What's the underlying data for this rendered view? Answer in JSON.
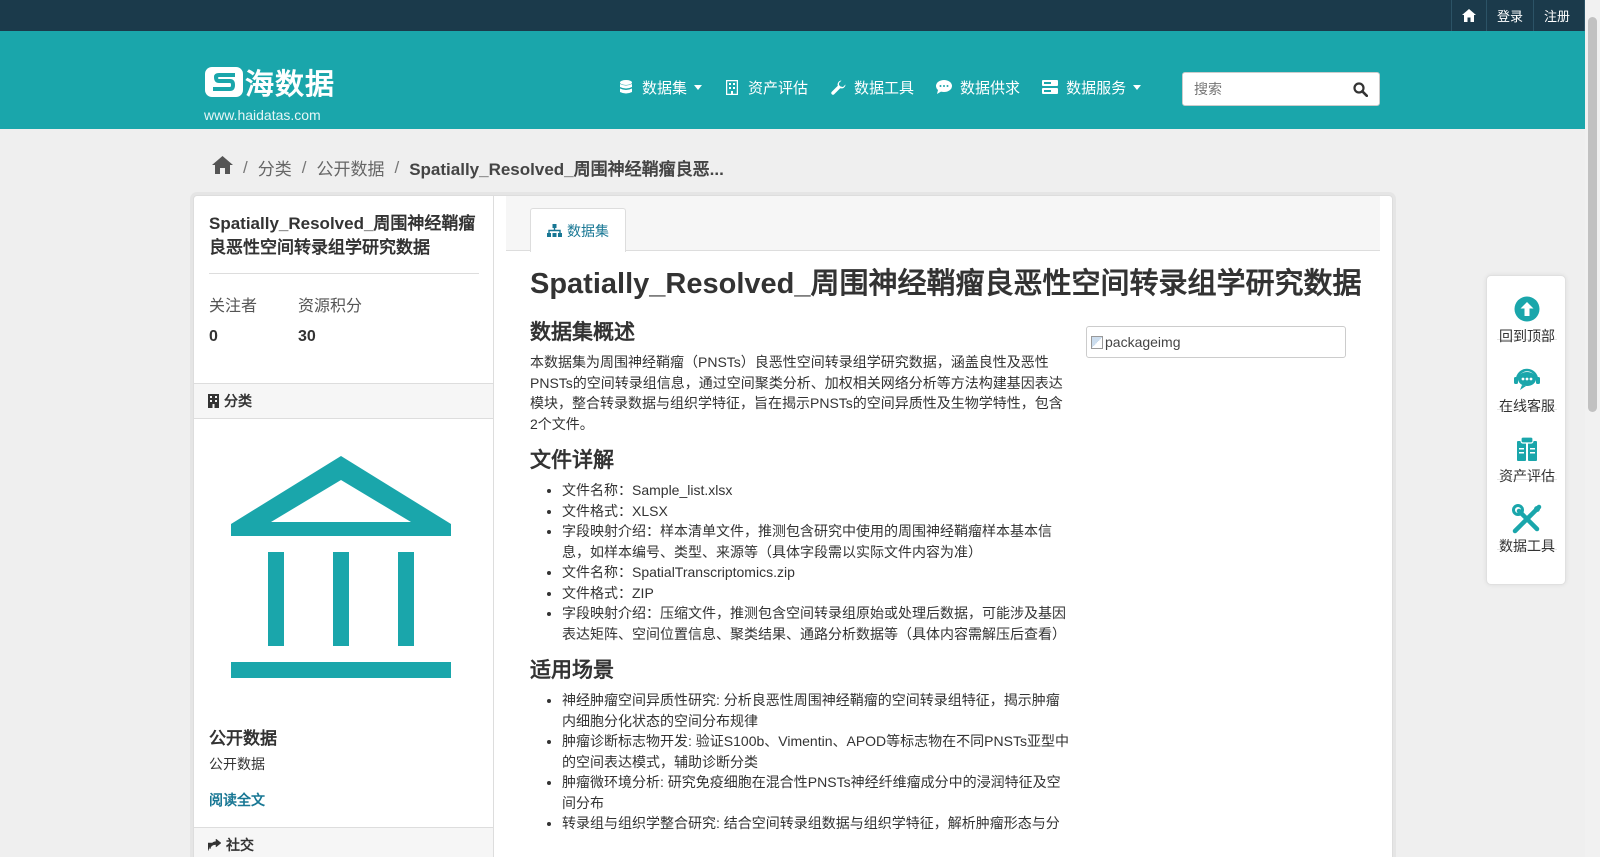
{
  "account": {
    "login": "登录",
    "register": "注册"
  },
  "brand": {
    "name": "海数据",
    "url": "www.haidatas.com"
  },
  "nav": {
    "datasets": "数据集",
    "assessment": "资产评估",
    "tools": "数据工具",
    "supply": "数据供求",
    "services": "数据服务"
  },
  "search": {
    "placeholder": "搜索"
  },
  "breadcrumb": {
    "category": "分类",
    "org": "公开数据",
    "current": "Spatially_Resolved_周围神经鞘瘤良恶..."
  },
  "sidebar": {
    "title": "Spatially_Resolved_周围神经鞘瘤良恶性空间转录组学研究数据",
    "followers_label": "关注者",
    "followers_value": "0",
    "points_label": "资源积分",
    "points_value": "30",
    "category_heading": "分类",
    "org_title": "公开数据",
    "org_desc": "公开数据",
    "read_more": "阅读全文",
    "social_heading": "社交"
  },
  "tab": {
    "label": "数据集"
  },
  "dataset": {
    "title": "Spatially_Resolved_周围神经鞘瘤良恶性空间转录组学研究数据",
    "overview_heading": "数据集概述",
    "overview_text": "本数据集为周围神经鞘瘤（PNSTs）良恶性空间转录组学研究数据，涵盖良性及恶性PNSTs的空间转录组信息，通过空间聚类分析、加权相关网络分析等方法构建基因表达模块，整合转录数据与组织学特征，旨在揭示PNSTs的空间异质性及生物学特性，包含2个文件。",
    "files_heading": "文件详解",
    "files": [
      "文件名称：Sample_list.xlsx",
      "文件格式：XLSX",
      "字段映射介绍：样本清单文件，推测包含研究中使用的周围神经鞘瘤样本基本信息，如样本编号、类型、来源等（具体字段需以实际文件内容为准）",
      "文件名称：SpatialTranscriptomics.zip",
      "文件格式：ZIP",
      "字段映射介绍：压缩文件，推测包含空间转录组原始或处理后数据，可能涉及基因表达矩阵、空间位置信息、聚类结果、通路分析数据等（具体内容需解压后查看）"
    ],
    "scenarios_heading": "适用场景",
    "scenarios": [
      "神经肿瘤空间异质性研究: 分析良恶性周围神经鞘瘤的空间转录组特征，揭示肿瘤内细胞分化状态的空间分布规律",
      "肿瘤诊断标志物开发: 验证S100b、Vimentin、APOD等标志物在不同PNSTs亚型中的空间表达模式，辅助诊断分类",
      "肿瘤微环境分析: 研究免疫细胞在混合性PNSTs神经纤维瘤成分中的浸润特征及空间分布",
      "转录组与组织学整合研究: 结合空间转录组数据与组织学特征，解析肿瘤形态与分"
    ],
    "image_alt": "packageimg"
  },
  "float_tools": {
    "top": "回到顶部",
    "service": "在线客服",
    "assessment": "资产评估",
    "tools": "数据工具"
  },
  "colors": {
    "topbar": "#1b3a4b",
    "brand_teal": "#1aa6ab",
    "link": "#187794"
  }
}
